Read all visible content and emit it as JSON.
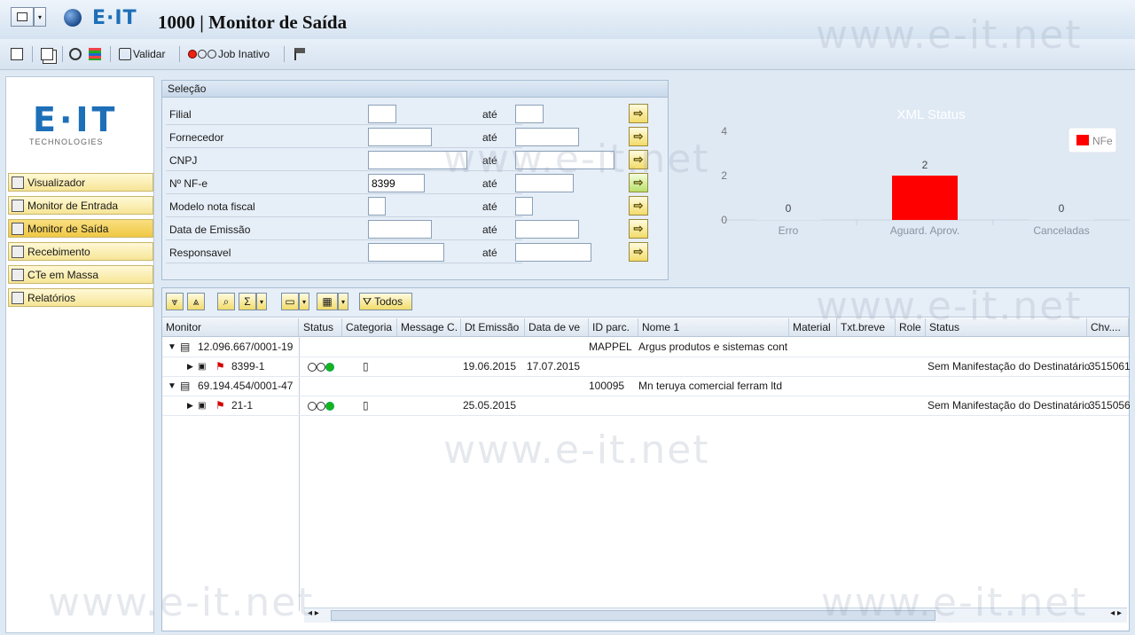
{
  "window": {
    "title": "1000 | Monitor de Saída",
    "brand": "E·IT"
  },
  "toolbar": {
    "validar": "Validar",
    "job_inativo": "Job Inativo"
  },
  "sidebar": {
    "logo": "E·IT",
    "logo_sub": "TECHNOLOGIES",
    "items": [
      {
        "label": "Visualizador"
      },
      {
        "label": "Monitor de Entrada"
      },
      {
        "label": "Monitor de Saída"
      },
      {
        "label": "Recebimento"
      },
      {
        "label": "CTe em Massa"
      },
      {
        "label": "Relatórios"
      }
    ]
  },
  "selection": {
    "title": "Seleção",
    "to_label": "até",
    "rows": [
      {
        "label": "Filial",
        "from": "",
        "to": ""
      },
      {
        "label": "Fornecedor",
        "from": "",
        "to": ""
      },
      {
        "label": "CNPJ",
        "from": "",
        "to": ""
      },
      {
        "label": "Nº NF-e",
        "from": "8399",
        "to": ""
      },
      {
        "label": "Modelo nota fiscal",
        "from": "",
        "to": ""
      },
      {
        "label": "Data de Emissão",
        "from": "",
        "to": ""
      },
      {
        "label": "Responsavel",
        "from": "",
        "to": ""
      }
    ]
  },
  "chart_data": {
    "type": "bar",
    "title": "XML Status",
    "categories": [
      "Erro",
      "Aguard. Aprov.",
      "Canceladas"
    ],
    "series": [
      {
        "name": "NFe",
        "values": [
          0,
          2,
          0
        ],
        "color": "#ff0000"
      }
    ],
    "ylim": [
      0,
      4
    ],
    "yticks": [
      "0",
      "2",
      "4"
    ],
    "legend": "top-right"
  },
  "grid": {
    "todos_label": "Todos",
    "columns": [
      "Monitor",
      "Status",
      "Categoria",
      "Message C.",
      "Dt Emissão",
      "Data de ve",
      "ID parc.",
      "Nome 1",
      "Material",
      "Txt.breve",
      "Role",
      "Status",
      "Chv...."
    ],
    "rows": [
      {
        "monitor": "12.096.667/0001-19",
        "id_parc": "MAPPEL",
        "nome": "Argus produtos e sistemas cont"
      },
      {
        "monitor": "8399-1",
        "dt_emissao": "19.06.2015",
        "data_ve": "17.07.2015",
        "status_text": "Sem Manifestação do Destinatário",
        "chave": "3515061"
      },
      {
        "monitor": "69.194.454/0001-47",
        "id_parc": "100095",
        "nome": "Mn teruya comercial ferram ltd"
      },
      {
        "monitor": "21-1",
        "dt_emissao": "25.05.2015",
        "status_text": "Sem Manifestação do Destinatário",
        "chave": "3515056"
      }
    ]
  },
  "watermark": "www.e-it.net"
}
